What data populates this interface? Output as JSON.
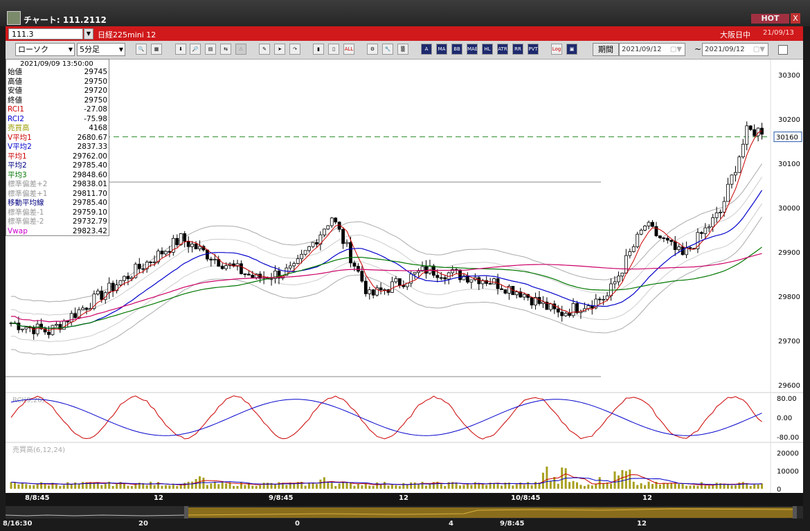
{
  "window": {
    "title": "チャート: 111.2112",
    "hot_label": "HOT",
    "close_label": "X"
  },
  "header": {
    "symbol": "111.3",
    "market": "日経225mini 12",
    "session": "大阪日中",
    "date": "21/09/13"
  },
  "toolbar": {
    "chart_type": "ローソク",
    "interval": "5分足",
    "period_label": "期間",
    "date_from": "2021/09/12",
    "date_to": "2021/09/12",
    "tilde": "~",
    "indicator_buttons": [
      "MA",
      "BB",
      "MAE",
      "HL",
      "ATR",
      "RR",
      "PVT",
      "Log"
    ]
  },
  "info_panel": {
    "datetime": "2021/09/09  13:50:00",
    "rows": [
      {
        "label": "始値",
        "value": "29745",
        "color": "#000000"
      },
      {
        "label": "高値",
        "value": "29750",
        "color": "#000000"
      },
      {
        "label": "安値",
        "value": "29720",
        "color": "#000000"
      },
      {
        "label": "終値",
        "value": "29750",
        "color": "#000000"
      },
      {
        "label": "RCI1",
        "value": "-27.08",
        "color": "#cc0000"
      },
      {
        "label": "RCI2",
        "value": "-75.98",
        "color": "#0000cc"
      },
      {
        "label": "売買高",
        "value": "4168",
        "color": "#999900"
      },
      {
        "label": "V平均1",
        "value": "2680.67",
        "color": "#cc0000"
      },
      {
        "label": "V平均2",
        "value": "2837.33",
        "color": "#0000cc"
      },
      {
        "label": "平均1",
        "value": "29762.00",
        "color": "#cc0000"
      },
      {
        "label": "平均2",
        "value": "29785.40",
        "color": "#000080"
      },
      {
        "label": "平均3",
        "value": "29848.60",
        "color": "#007700"
      },
      {
        "label": "標準偏差+2",
        "value": "29838.01",
        "color": "#999999"
      },
      {
        "label": "標準偏差+1",
        "value": "29811.70",
        "color": "#999999"
      },
      {
        "label": "移動平均線",
        "value": "29785.40",
        "color": "#000080"
      },
      {
        "label": "標準偏差-1",
        "value": "29759.10",
        "color": "#999999"
      },
      {
        "label": "標準偏差-2",
        "value": "29732.79",
        "color": "#999999"
      },
      {
        "label": "Vwap",
        "value": "29823.42",
        "color": "#cc00cc"
      }
    ]
  },
  "price_axis": {
    "ticks": [
      "30300",
      "30200",
      "30100",
      "30000",
      "29900",
      "29800",
      "29700",
      "29600"
    ],
    "current": "30160"
  },
  "rci_panel": {
    "label": "RCI(9,26)",
    "ticks": [
      "80.00",
      "0.00",
      "-80.00"
    ]
  },
  "volume_panel": {
    "label": "売買高(6,12,24)",
    "ticks": [
      "20000",
      "10000",
      "0"
    ]
  },
  "x_axis": {
    "labels": [
      "8/8:45",
      "12",
      "9/8:45",
      "12",
      "10/8:45",
      "12"
    ]
  },
  "overview_axis": {
    "labels": [
      "8/16:30",
      "20",
      "0",
      "4",
      "9/8:45",
      "12"
    ]
  },
  "colors": {
    "title_bar": "#2e2e2e",
    "red_bar": "#d0191b",
    "rci_fast": "#cc0000",
    "rci_slow": "#0000cc",
    "volume_bar": "#a8a020",
    "ma1": "#cc0000",
    "ma2": "#0000cc",
    "ma3": "#007700",
    "vwap": "#cc0066"
  }
}
